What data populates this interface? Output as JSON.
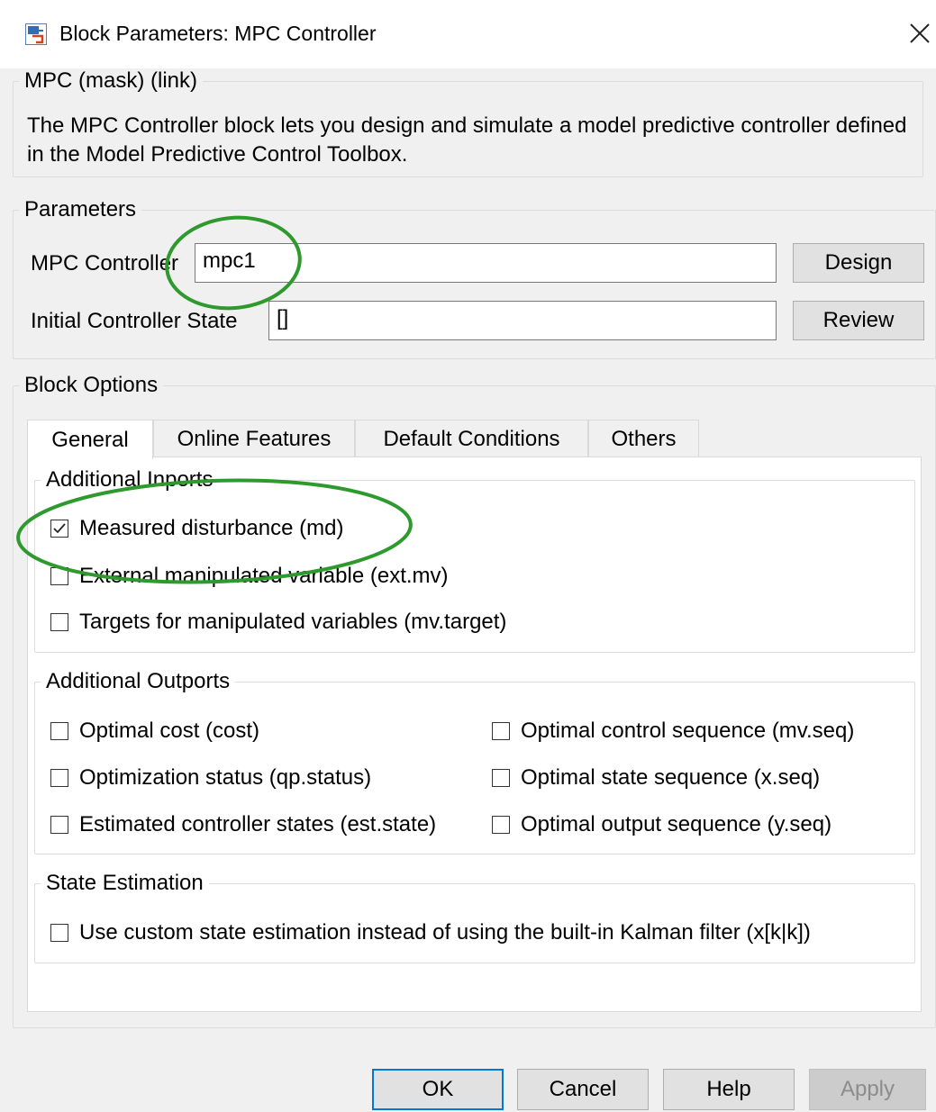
{
  "window": {
    "title": "Block Parameters: MPC Controller",
    "icon": "simulink-block-icon",
    "close_icon": "close-icon"
  },
  "mask_group": {
    "legend": "MPC (mask) (link)",
    "description": "The MPC Controller block lets you design and simulate a model predictive controller defined in the Model Predictive Control Toolbox."
  },
  "parameters": {
    "legend": "Parameters",
    "mpc_controller": {
      "label": "MPC Controller",
      "value": "mpc1",
      "button": "Design"
    },
    "initial_state": {
      "label": "Initial Controller State",
      "value": "[]",
      "button": "Review"
    }
  },
  "block_options": {
    "legend": "Block Options",
    "tabs": [
      {
        "label": "General",
        "active": true
      },
      {
        "label": "Online Features",
        "active": false
      },
      {
        "label": "Default Conditions",
        "active": false
      },
      {
        "label": "Others",
        "active": false
      }
    ],
    "additional_inports": {
      "legend": "Additional Inports",
      "items": [
        {
          "label": "Measured disturbance (md)",
          "checked": true
        },
        {
          "label": "External manipulated variable (ext.mv)",
          "checked": false
        },
        {
          "label": "Targets for manipulated variables (mv.target)",
          "checked": false
        }
      ]
    },
    "additional_outports": {
      "legend": "Additional Outports",
      "left": [
        {
          "label": "Optimal cost (cost)",
          "checked": false
        },
        {
          "label": "Optimization status (qp.status)",
          "checked": false
        },
        {
          "label": "Estimated controller states (est.state)",
          "checked": false
        }
      ],
      "right": [
        {
          "label": "Optimal control sequence (mv.seq)",
          "checked": false
        },
        {
          "label": "Optimal state sequence (x.seq)",
          "checked": false
        },
        {
          "label": "Optimal output sequence (y.seq)",
          "checked": false
        }
      ]
    },
    "state_estimation": {
      "legend": "State Estimation",
      "items": [
        {
          "label": "Use custom state estimation instead of using the built-in Kalman filter (x[k|k])",
          "checked": false
        }
      ]
    }
  },
  "footer": {
    "ok": "OK",
    "cancel": "Cancel",
    "help": "Help",
    "apply": "Apply"
  },
  "colors": {
    "annotation": "#2e9a2e",
    "focus_border": "#0078d7"
  }
}
